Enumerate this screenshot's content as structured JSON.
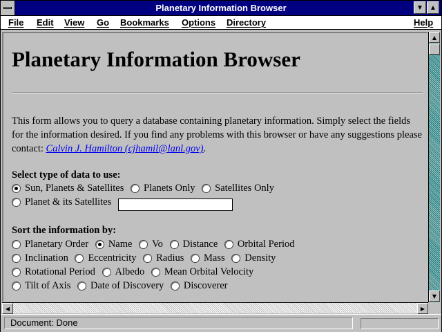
{
  "window": {
    "title": "Planetary Information Browser",
    "minimize_glyph": "▼",
    "maximize_glyph": "▲"
  },
  "menu": {
    "items": [
      "File",
      "Edit",
      "View",
      "Go",
      "Bookmarks",
      "Options",
      "Directory",
      "Help"
    ]
  },
  "page": {
    "heading": "Planetary Information Browser",
    "intro_text": "This form allows you to query a database containing planetary information. Simply select the fields for the information desired. If you find any problems with this browser or have any suggestions please contact: ",
    "contact_link": "Calvin J. Hamilton (cjhamil@lanl.gov)",
    "intro_end": ".",
    "data_type": {
      "label": "Select type of data to use:",
      "options": [
        {
          "label": "Sun, Planets & Satellites",
          "selected": true
        },
        {
          "label": "Planets Only",
          "selected": false
        },
        {
          "label": "Satellites Only",
          "selected": false
        },
        {
          "label": "Planet & its Satellites",
          "selected": false
        }
      ],
      "planet_input_value": ""
    },
    "sort": {
      "label": "Sort the information by:",
      "options": [
        {
          "label": "Planetary Order",
          "selected": false
        },
        {
          "label": "Name",
          "selected": true
        },
        {
          "label": "Vo",
          "selected": false
        },
        {
          "label": "Distance",
          "selected": false
        },
        {
          "label": "Orbital Period",
          "selected": false
        },
        {
          "label": "Inclination",
          "selected": false
        },
        {
          "label": "Eccentricity",
          "selected": false
        },
        {
          "label": "Radius",
          "selected": false
        },
        {
          "label": "Mass",
          "selected": false
        },
        {
          "label": "Density",
          "selected": false
        },
        {
          "label": "Rotational Period",
          "selected": false
        },
        {
          "label": "Albedo",
          "selected": false
        },
        {
          "label": "Mean Orbital Velocity",
          "selected": false
        },
        {
          "label": "Tilt of Axis",
          "selected": false
        },
        {
          "label": "Date of Discovery",
          "selected": false
        },
        {
          "label": "Discoverer",
          "selected": false
        }
      ]
    }
  },
  "scrollbars": {
    "up_glyph": "▲",
    "down_glyph": "▼",
    "left_glyph": "◀",
    "right_glyph": "▶"
  },
  "status": {
    "text": "Document: Done"
  },
  "colors": {
    "title_bar": "#000080",
    "face": "#c0c0c0",
    "link": "#0000ee",
    "scroll_track": "#008080"
  }
}
